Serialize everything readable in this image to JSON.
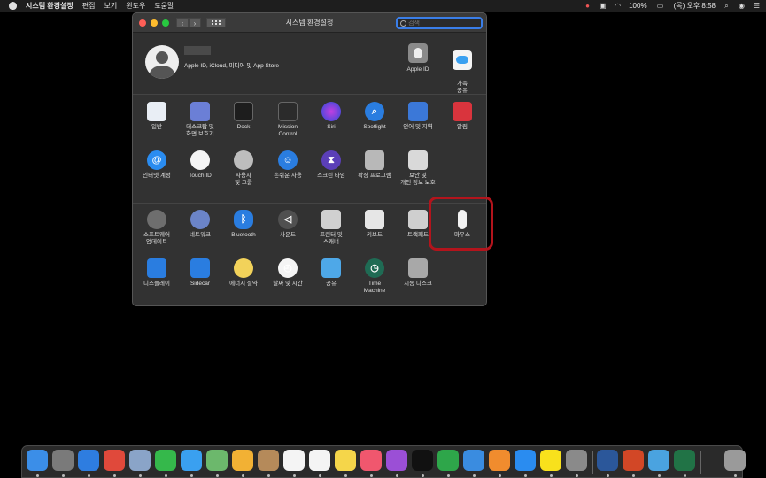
{
  "menubar": {
    "app_name": "시스템 환경설정",
    "menus": [
      "편집",
      "보기",
      "윈도우",
      "도움말"
    ],
    "status": {
      "battery": "100%",
      "clock": "(목) 오후 8:58"
    }
  },
  "window": {
    "title": "시스템 환경설정",
    "search_placeholder": "검색"
  },
  "account": {
    "description": "Apple ID, iCloud, 미디어 및 App Store",
    "items": [
      {
        "label": "Apple ID",
        "icon": "apple-id-icon"
      },
      {
        "label": "가족\n공유",
        "icon": "family-sharing-icon"
      }
    ]
  },
  "sections": [
    {
      "items": [
        {
          "label": "일반",
          "icon": "general-icon"
        },
        {
          "label": "데스크탑 및\n화면 보호기",
          "icon": "desktop-icon"
        },
        {
          "label": "Dock",
          "icon": "dock-icon"
        },
        {
          "label": "Mission\nControl",
          "icon": "mission-control-icon"
        },
        {
          "label": "Siri",
          "icon": "siri-icon"
        },
        {
          "label": "Spotlight",
          "icon": "spotlight-icon"
        },
        {
          "label": "언어 및 지역",
          "icon": "language-region-icon"
        },
        {
          "label": "알림",
          "icon": "notifications-icon"
        },
        {
          "label": "인터넷 계정",
          "icon": "internet-accounts-icon"
        },
        {
          "label": "Touch ID",
          "icon": "touch-id-icon"
        },
        {
          "label": "사용자\n및 그룹",
          "icon": "users-groups-icon"
        },
        {
          "label": "손쉬운 사용",
          "icon": "accessibility-icon"
        },
        {
          "label": "스크린 타임",
          "icon": "screen-time-icon"
        },
        {
          "label": "확장 프로그램",
          "icon": "extensions-icon"
        },
        {
          "label": "보안 및\n개인 정보 보호",
          "icon": "security-icon"
        }
      ]
    },
    {
      "items": [
        {
          "label": "소프트웨어\n업데이트",
          "icon": "software-update-icon"
        },
        {
          "label": "네트워크",
          "icon": "network-icon"
        },
        {
          "label": "Bluetooth",
          "icon": "bluetooth-icon"
        },
        {
          "label": "사운드",
          "icon": "sound-icon"
        },
        {
          "label": "프린터 및\n스캐너",
          "icon": "printer-icon"
        },
        {
          "label": "키보드",
          "icon": "keyboard-icon"
        },
        {
          "label": "트랙패드",
          "icon": "trackpad-icon"
        },
        {
          "label": "마우스",
          "icon": "mouse-icon"
        },
        {
          "label": "디스플레이",
          "icon": "displays-icon"
        },
        {
          "label": "Sidecar",
          "icon": "sidecar-icon"
        },
        {
          "label": "에너지 절약",
          "icon": "energy-saver-icon"
        },
        {
          "label": "날짜 및 시간",
          "icon": "date-time-icon"
        },
        {
          "label": "공유",
          "icon": "sharing-icon"
        },
        {
          "label": "Time\nMachine",
          "icon": "time-machine-icon"
        },
        {
          "label": "시동 디스크",
          "icon": "startup-disk-icon"
        }
      ]
    }
  ],
  "colors": {
    "highlight": "#b3141c",
    "window_bg": "#323232",
    "accent": "#3a7ee8"
  },
  "dock": {
    "apps": [
      {
        "name": "finder-icon",
        "color": "#3b8ee8"
      },
      {
        "name": "launchpad-icon",
        "color": "#7a7a7a"
      },
      {
        "name": "safari-icon",
        "color": "#2e7de0"
      },
      {
        "name": "chrome-icon",
        "color": "#e0493b"
      },
      {
        "name": "preview-icon",
        "color": "#8aa4c8"
      },
      {
        "name": "facetime-icon",
        "color": "#35b84b"
      },
      {
        "name": "messages-icon",
        "color": "#3aa0f0"
      },
      {
        "name": "maps-icon",
        "color": "#6cb86c"
      },
      {
        "name": "photos-icon",
        "color": "#f2b134"
      },
      {
        "name": "contacts-icon",
        "color": "#b58a5a"
      },
      {
        "name": "calendar-icon",
        "color": "#f4f4f4"
      },
      {
        "name": "reminders-icon",
        "color": "#f4f4f4"
      },
      {
        "name": "notes-icon",
        "color": "#f5d64a"
      },
      {
        "name": "music-icon",
        "color": "#f0576e"
      },
      {
        "name": "podcasts-icon",
        "color": "#9b4fd6"
      },
      {
        "name": "apple-tv-icon",
        "color": "#111111"
      },
      {
        "name": "numbers-icon",
        "color": "#2ea64a"
      },
      {
        "name": "keynote-icon",
        "color": "#3a8ce0"
      },
      {
        "name": "pages-icon",
        "color": "#f08c2e"
      },
      {
        "name": "app-store-icon",
        "color": "#2a8cf0"
      },
      {
        "name": "kakaotalk-icon",
        "color": "#f8e11c"
      },
      {
        "name": "system-preferences-icon",
        "color": "#8a8a8a"
      },
      {
        "name": "word-icon",
        "color": "#2b579a"
      },
      {
        "name": "powerpoint-icon",
        "color": "#d24726"
      },
      {
        "name": "finder-alt-icon",
        "color": "#4aa3e0"
      },
      {
        "name": "excel-icon",
        "color": "#217346"
      },
      {
        "name": "trash-icon",
        "color": "#9a9a9a"
      }
    ]
  }
}
